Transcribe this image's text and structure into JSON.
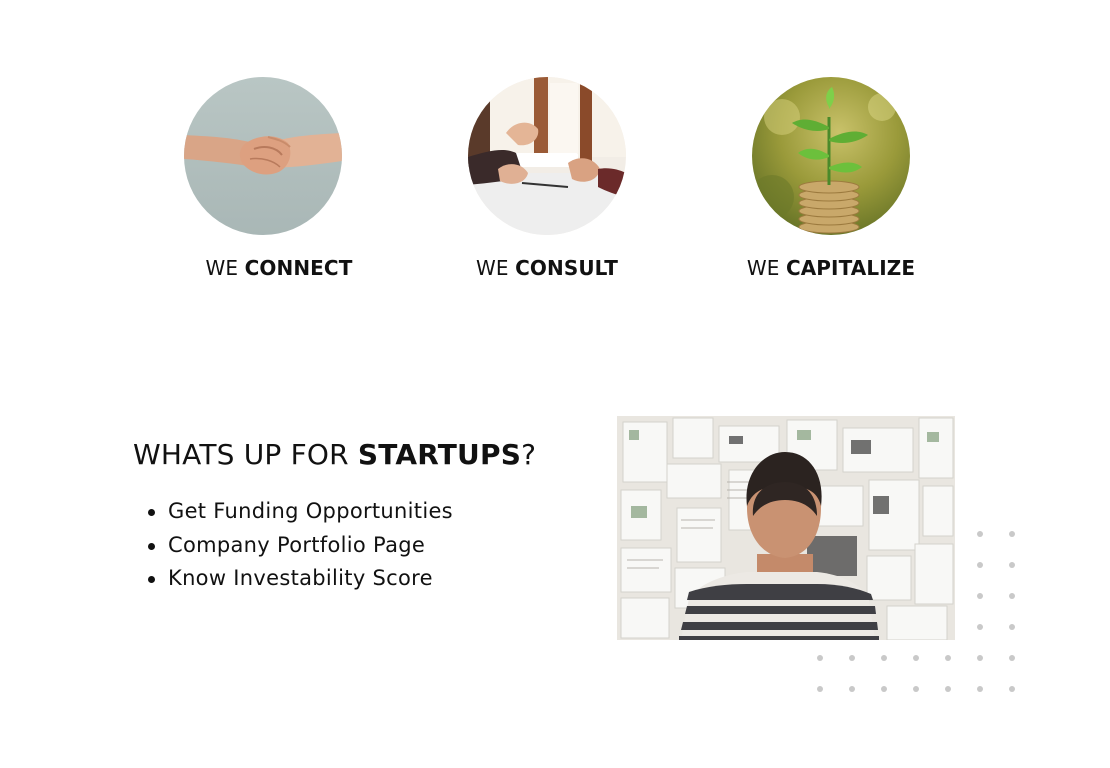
{
  "pillars": [
    {
      "prefix": "WE ",
      "bold": "CONNECT",
      "image": "handshake-image"
    },
    {
      "prefix": "WE ",
      "bold": "CONSULT",
      "image": "meeting-image"
    },
    {
      "prefix": "WE ",
      "bold": "CAPITALIZE",
      "image": "plant-on-coins-image"
    }
  ],
  "startups": {
    "heading_prefix": "WHATS UP FOR ",
    "heading_bold": "STARTUPS",
    "heading_suffix": "?",
    "items": [
      "Get Funding Opportunities",
      "Company Portfolio Page",
      "Know Investability Score"
    ],
    "image": "man-looking-at-board-image"
  },
  "colors": {
    "text": "#111111",
    "dot_grid": "#c9c9c9",
    "background": "#ffffff"
  }
}
